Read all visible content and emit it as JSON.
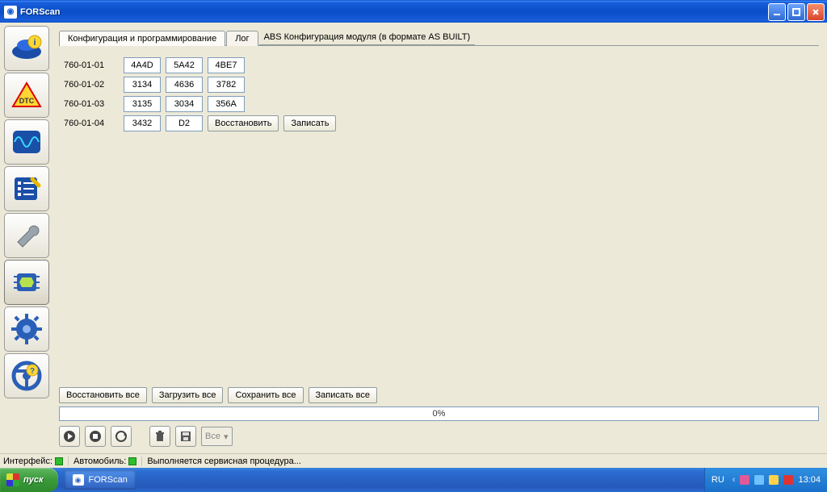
{
  "window": {
    "title": "FORScan"
  },
  "tabs": {
    "config": "Конфигурация и программирование",
    "log": "Лог",
    "header": "ABS Конфигурация модуля (в формате AS BUILT)"
  },
  "rows": [
    {
      "label": "760-01-01",
      "cells": [
        "4A4D",
        "5A42",
        "4BE7"
      ]
    },
    {
      "label": "760-01-02",
      "cells": [
        "3134",
        "4636",
        "3782"
      ]
    },
    {
      "label": "760-01-03",
      "cells": [
        "3135",
        "3034",
        "356A"
      ]
    },
    {
      "label": "760-01-04",
      "cells": [
        "3432",
        "D2"
      ]
    }
  ],
  "row_buttons": {
    "restore": "Восстановить",
    "write": "Записать"
  },
  "bottom_buttons": {
    "restore_all": "Восстановить все",
    "load_all": "Загрузить все",
    "save_all": "Сохранить все",
    "write_all": "Записать все"
  },
  "progress": {
    "text": "0%"
  },
  "combo": {
    "label": "Все",
    "chevron": "▾"
  },
  "status": {
    "interface_label": "Интерфейс:",
    "vehicle_label": "Автомобиль:",
    "message": "Выполняется сервисная процедура..."
  },
  "taskbar": {
    "start": "пуск",
    "app": "FORScan",
    "lang": "RU",
    "clock": "13:04"
  },
  "sidebar_icons": [
    "vehicle-info",
    "dtc",
    "oscilloscope",
    "tests",
    "service",
    "chip",
    "settings-gear",
    "steering"
  ]
}
